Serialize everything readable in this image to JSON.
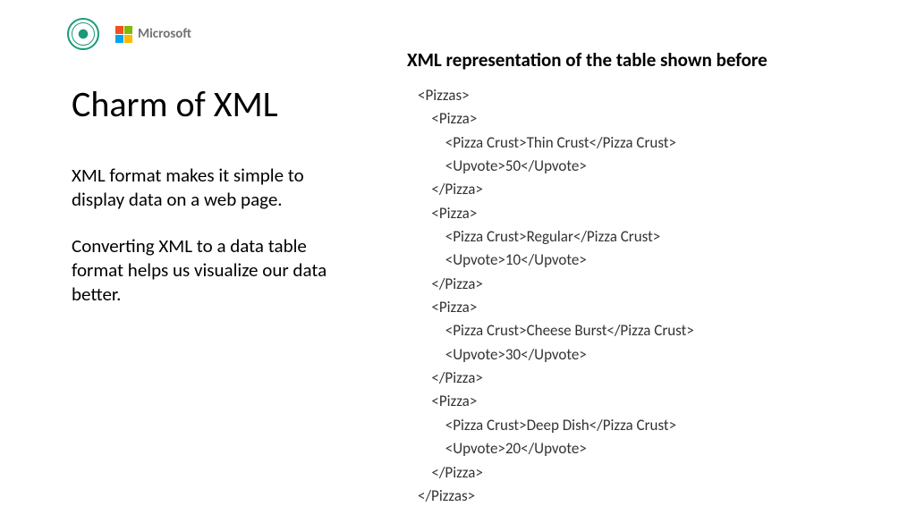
{
  "logos": {
    "microsoft_label": "Microsoft"
  },
  "left": {
    "title": "Charm of XML",
    "para1": "XML format makes it simple to display data on a web page.",
    "para2": "Converting XML to a data table format helps us visualize our data better."
  },
  "right": {
    "heading": "XML representation of the table shown before",
    "xml": "<Pizzas>\n    <Pizza>\n        <Pizza Crust>Thin Crust</Pizza Crust>\n        <Upvote>50</Upvote>\n    </Pizza>\n    <Pizza>\n        <Pizza Crust>Regular</Pizza Crust>\n        <Upvote>10</Upvote>\n    </Pizza>\n    <Pizza>\n        <Pizza Crust>Cheese Burst</Pizza Crust>\n        <Upvote>30</Upvote>\n    </Pizza>\n    <Pizza>\n        <Pizza Crust>Deep Dish</Pizza Crust>\n        <Upvote>20</Upvote>\n    </Pizza>\n</Pizzas>"
  }
}
